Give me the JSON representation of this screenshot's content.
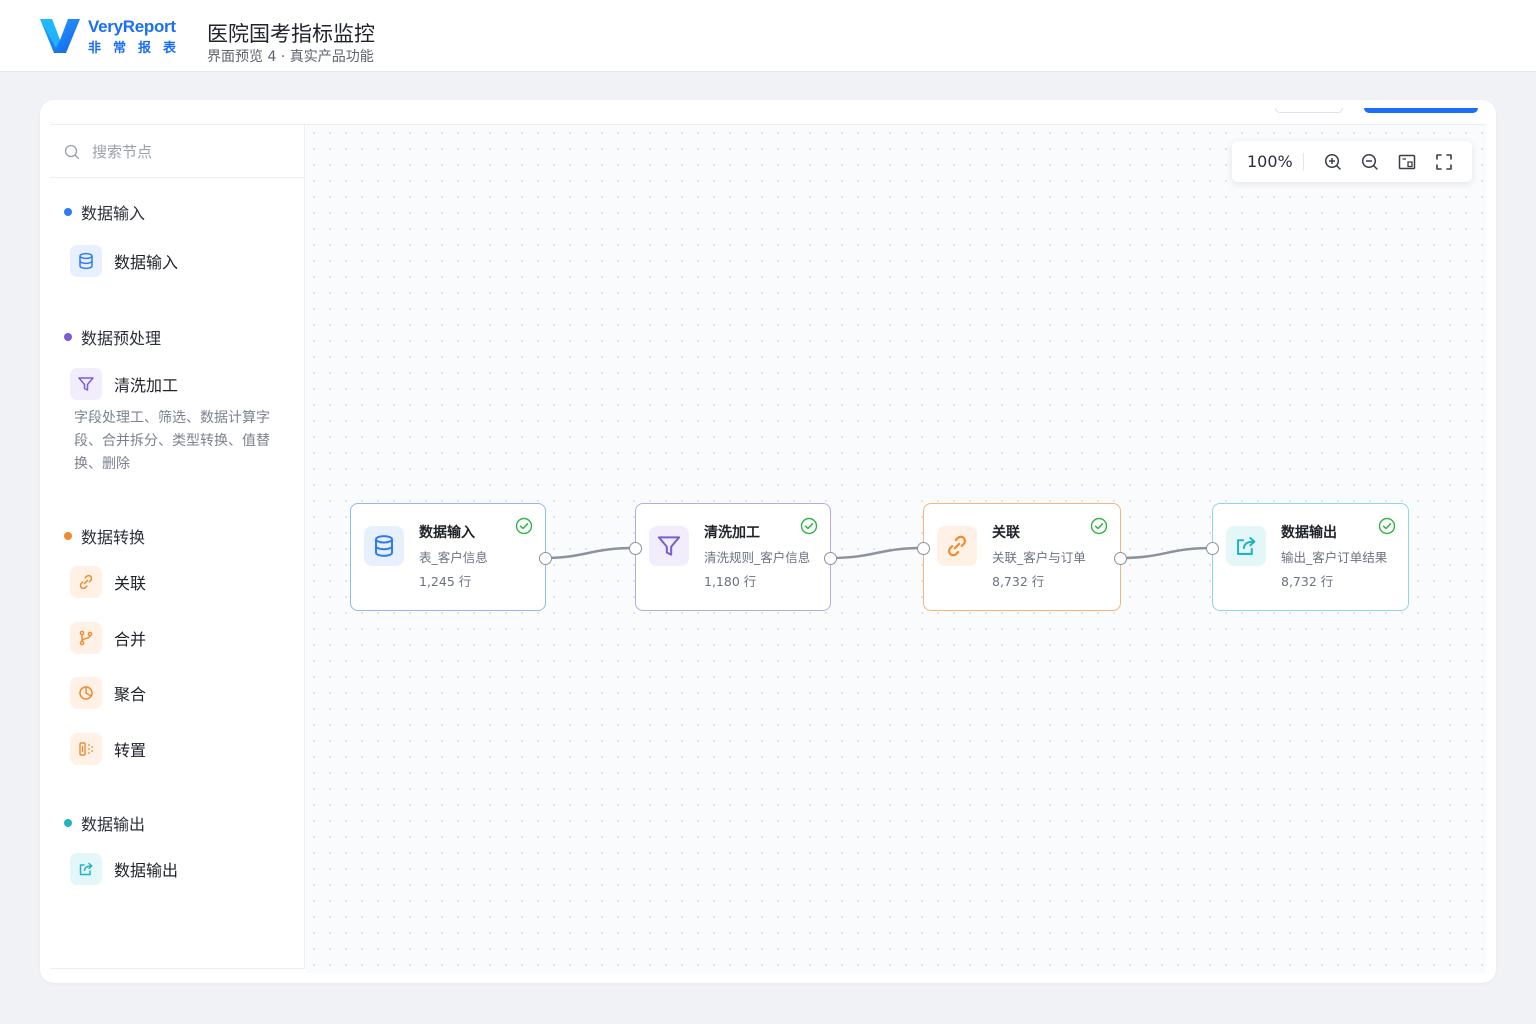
{
  "header": {
    "brand": "VeryReport",
    "brand_sub": "非常报表",
    "title": "医院国考指标监控",
    "subtitle": "界面预览 4 · 真实产品功能"
  },
  "colors": {
    "primary": "#1a6ff5",
    "input": "#2f7bf6",
    "preprocess": "#7b5cd6",
    "transform": "#f08a2e",
    "output": "#22b3c2",
    "success": "#2fb344"
  },
  "sidebar": {
    "search_placeholder": "搜索节点",
    "groups": [
      {
        "title": "数据输入",
        "items": [
          {
            "label": "数据输入",
            "icon": "database-icon"
          }
        ]
      },
      {
        "title": "数据预处理",
        "items": [
          {
            "label": "清洗加工",
            "icon": "filter-icon"
          }
        ],
        "description": "字段处理工、筛选、数据计算字段、合并拆分、类型转换、值替换、删除"
      },
      {
        "title": "数据转换",
        "items": [
          {
            "label": "关联",
            "icon": "link-icon"
          },
          {
            "label": "合并",
            "icon": "merge-icon"
          },
          {
            "label": "聚合",
            "icon": "aggregate-icon"
          },
          {
            "label": "转置",
            "icon": "transpose-icon"
          }
        ]
      },
      {
        "title": "数据输出",
        "items": [
          {
            "label": "数据输出",
            "icon": "export-icon"
          }
        ]
      }
    ]
  },
  "canvas": {
    "zoom": "100%",
    "tools": [
      "zoom-in-icon",
      "zoom-out-icon",
      "fit-view-icon",
      "fullscreen-icon"
    ],
    "nodes": [
      {
        "title": "数据输入",
        "subtitle": "表_客户信息",
        "count": "1,245 行",
        "status": "success",
        "icon": "database-icon"
      },
      {
        "title": "清洗加工",
        "subtitle": "清洗规则_客户信息",
        "count": "1,180 行",
        "status": "success",
        "icon": "filter-icon"
      },
      {
        "title": "关联",
        "subtitle": "关联_客户与订单",
        "count": "8,732 行",
        "status": "success",
        "icon": "link-icon"
      },
      {
        "title": "数据输出",
        "subtitle": "输出_客户订单结果",
        "count": "8,732 行",
        "status": "success",
        "icon": "export-icon"
      }
    ]
  }
}
